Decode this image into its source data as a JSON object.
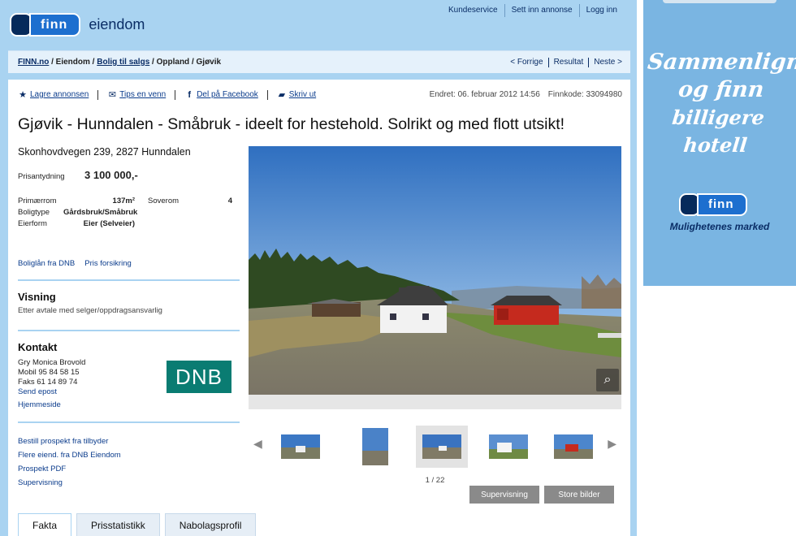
{
  "header": {
    "logo_word": "finn",
    "brand_suffix": "eiendom",
    "top_links": [
      "Kundeservice",
      "Sett inn annonse",
      "Logg inn"
    ]
  },
  "breadcrumb": {
    "items": [
      "FINN.no",
      "Eiendom",
      "Bolig til salgs",
      "Oppland",
      "Gjøvik"
    ],
    "separator": " / ",
    "pager": [
      "< Forrige",
      "Resultat",
      "Neste >"
    ]
  },
  "actions": {
    "save": "Lagre annonsen",
    "tip": "Tips en venn",
    "facebook": "Del på Facebook",
    "print": "Skriv ut"
  },
  "meta": {
    "changed_label": "Endret:",
    "changed_value": "06. februar 2012 14:56",
    "finnkode_label": "Finnkode:",
    "finnkode_value": "33094980"
  },
  "listing": {
    "title": "Gjøvik - Hunndalen - Småbruk - ideelt for hestehold. Solrikt og med flott utsikt!",
    "address": "Skonhovdvegen 239, 2827 Hunndalen",
    "price_label": "Prisantydning",
    "price_value": "3 100 000,-",
    "facts": {
      "primaerrom_label": "Primærrom",
      "primaerrom_value": "137m²",
      "soverom_label": "Soverom",
      "soverom_value": "4",
      "boligtype_label": "Boligtype",
      "boligtype_value": "Gårdsbruk/Småbruk",
      "eierform_label": "Eierform",
      "eierform_value": "Eier (Selveier)"
    },
    "loan_links": [
      "Boliglån fra DNB",
      "Pris forsikring"
    ]
  },
  "visning": {
    "heading": "Visning",
    "text": "Etter avtale med selger/oppdragsansvarlig"
  },
  "kontakt": {
    "heading": "Kontakt",
    "name": "Gry Monica Brovold",
    "mobil": "Mobil  95 84 58 15",
    "faks": "Faks  61 14 89 74",
    "email_link": "Send epost",
    "home_link": "Hjemmeside",
    "logo_text": "DNB"
  },
  "extra_links": [
    "Bestill prospekt fra tilbyder",
    "Flere eiend. fra DNB Eiendom",
    "Prospekt PDF",
    "Supervisning"
  ],
  "gallery": {
    "counter": "1 / 22",
    "supervisning_button": "Supervisning",
    "store_bilder_button": "Store bilder"
  },
  "tabs": [
    "Fakta",
    "Prisstatistikk",
    "Nabolagsprofil"
  ],
  "ad": {
    "line1": "Sammenlign",
    "line2": "og finn",
    "line3": "billigere hotell",
    "logo_word": "finn",
    "slogan": "Mulighetenes marked"
  },
  "colors": {
    "frame": "#a9d3f1",
    "finn_blue": "#1d6fcf",
    "finn_dark": "#062a5b",
    "dnb_green": "#0a7c72",
    "ad_bg": "#7ab5e2"
  }
}
